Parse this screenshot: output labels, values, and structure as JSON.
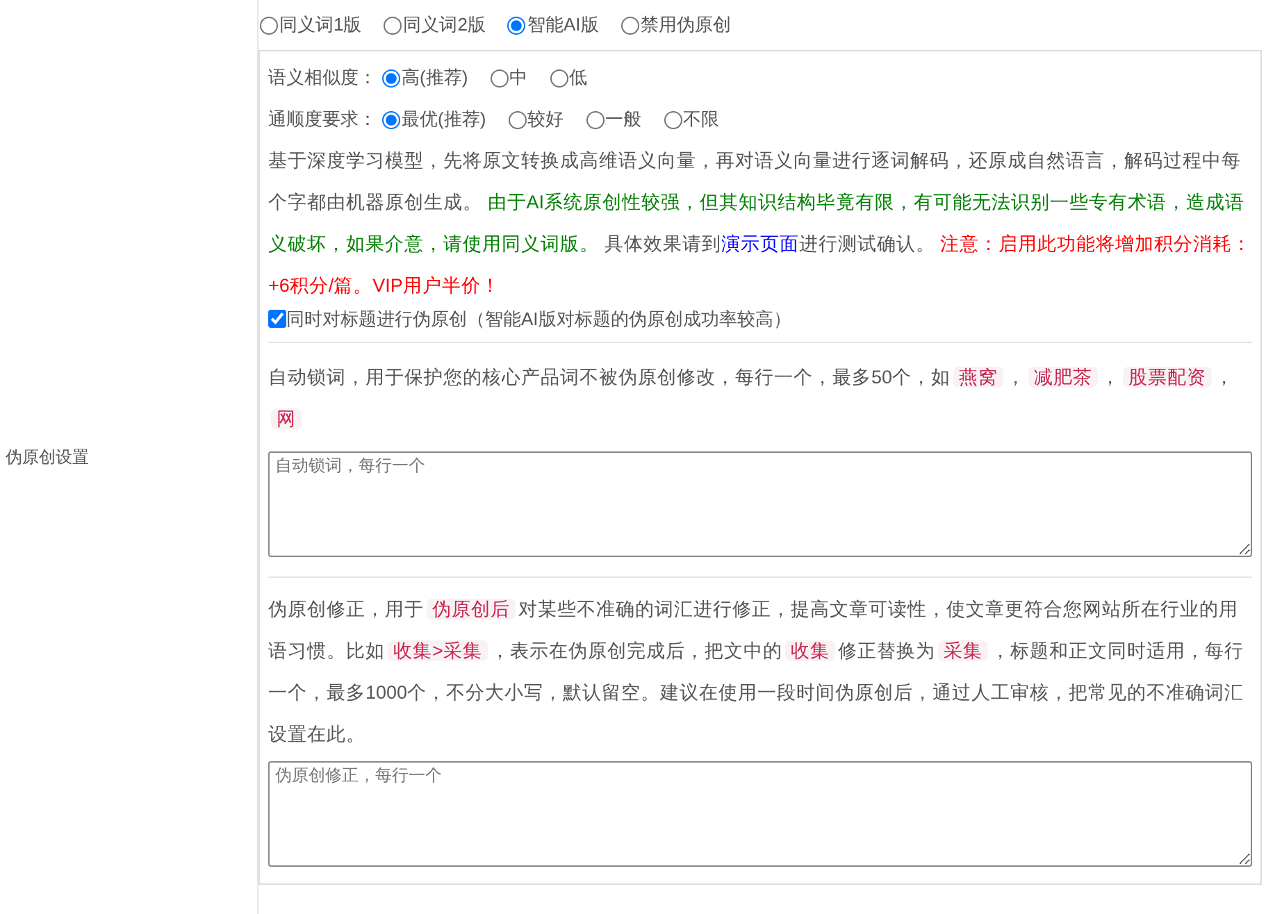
{
  "label": "伪原创设置",
  "modes": [
    {
      "label": "同义词1版",
      "selected": false
    },
    {
      "label": "同义词2版",
      "selected": false
    },
    {
      "label": "智能AI版",
      "selected": true
    },
    {
      "label": "禁用伪原创",
      "selected": false
    }
  ],
  "similarity": {
    "label": "语义相似度：",
    "options": [
      {
        "label": "高(推荐)",
        "selected": true
      },
      {
        "label": "中",
        "selected": false
      },
      {
        "label": "低",
        "selected": false
      }
    ]
  },
  "fluency": {
    "label": "通顺度要求：",
    "options": [
      {
        "label": "最优(推荐)",
        "selected": true
      },
      {
        "label": "较好",
        "selected": false
      },
      {
        "label": "一般",
        "selected": false
      },
      {
        "label": "不限",
        "selected": false
      }
    ]
  },
  "description": [
    {
      "kind": "normal",
      "text": "基于深度学习模型，先将原文转换成高维语义向量，再对语义向量进行逐词解码，还原成自然语言，解码过程中每个字都由机器原创生成。 "
    },
    {
      "kind": "green",
      "text": "由于AI系统原创性较强，但其知识结构毕竟有限，有可能无法识别一些专有术语，造成语义破坏，如果介意，请使用同义词版。"
    },
    {
      "kind": "normal",
      "text": " 具体效果请到"
    },
    {
      "kind": "link",
      "text": "演示页面"
    },
    {
      "kind": "normal",
      "text": "进行测试确认。 "
    },
    {
      "kind": "red",
      "text": "注意：启用此功能将增加积分消耗：+6积分/篇。VIP用户半价！"
    }
  ],
  "title_option": {
    "label": "同时对标题进行伪原创（智能AI版对标题的伪原创成功率较高）",
    "checked": true
  },
  "lock_words": {
    "segments": [
      {
        "kind": "text",
        "text": "自动锁词，用于保护您的核心产品词不被伪原创修改，每行一个，最多50个，如"
      },
      {
        "kind": "tag",
        "text": "燕窝"
      },
      {
        "kind": "text",
        "text": "，"
      },
      {
        "kind": "tag",
        "text": "减肥茶"
      },
      {
        "kind": "text",
        "text": "，"
      },
      {
        "kind": "tag",
        "text": "股票配资"
      },
      {
        "kind": "text",
        "text": "，"
      },
      {
        "kind": "tag",
        "text": "网"
      }
    ],
    "placeholder": "自动锁词，每行一个"
  },
  "correction": {
    "segments": [
      {
        "kind": "text",
        "text": "伪原创修正，用于"
      },
      {
        "kind": "tag",
        "text": "伪原创后"
      },
      {
        "kind": "text",
        "text": "对某些不准确的词汇进行修正，提高文章可读性，使文章更符合您网站所在行业的用语习惯。比如"
      },
      {
        "kind": "tag",
        "text": "收集>采集"
      },
      {
        "kind": "text",
        "text": "，表示在伪原创完成后，把文中的"
      },
      {
        "kind": "tag",
        "text": "收集"
      },
      {
        "kind": "text",
        "text": "修正替换为"
      },
      {
        "kind": "tag",
        "text": "采集"
      },
      {
        "kind": "text",
        "text": "，标题和正文同时适用，每行一个，最多1000个，不分大小写，默认留空。建议在使用一段时间伪原创后，通过人工审核，把常见的不准确词汇设置在此。"
      }
    ],
    "placeholder": "伪原创修正，每行一个"
  }
}
